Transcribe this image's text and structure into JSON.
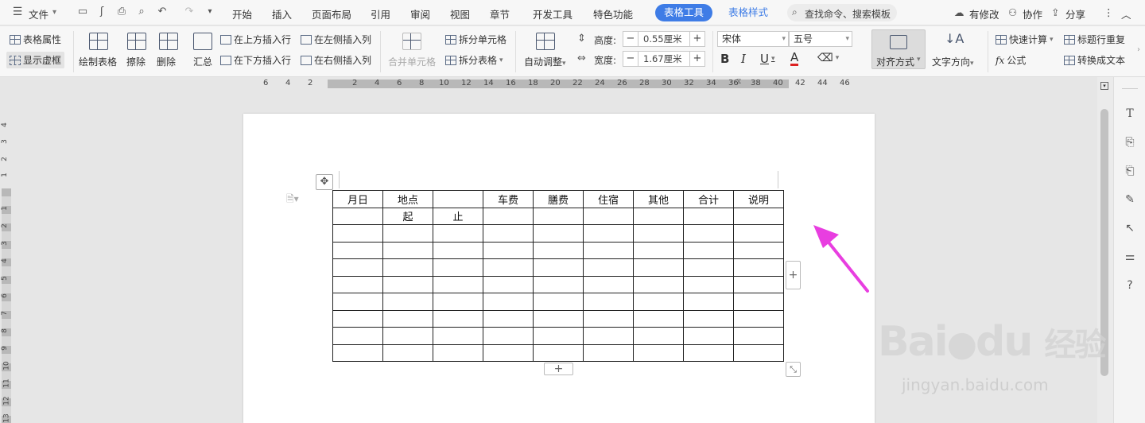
{
  "menubar": {
    "file_label": "文件",
    "tabs": [
      "开始",
      "插入",
      "页面布局",
      "引用",
      "审阅",
      "视图",
      "章节",
      "开发工具",
      "特色功能"
    ],
    "context_tab_active": "表格工具",
    "context_tab_2": "表格样式",
    "search_placeholder": "查找命令、搜索模板",
    "has_changes": "有修改",
    "collaborate": "协作",
    "share": "分享"
  },
  "ribbon": {
    "table_properties": "表格属性",
    "show_gridlines": "显示虚框",
    "draw_table": "绘制表格",
    "erase": "擦除",
    "delete": "删除",
    "summary": "汇总",
    "insert_row_above": "在上方插入行",
    "insert_row_below": "在下方插入行",
    "insert_col_left": "在左侧插入列",
    "insert_col_right": "在右侧插入列",
    "merge_cells": "合并单元格",
    "split_cells": "拆分单元格",
    "split_table": "拆分表格",
    "auto_fit": "自动调整",
    "height_label": "高度:",
    "height_value": "0.55厘米",
    "width_label": "宽度:",
    "width_value": "1.67厘米",
    "font_name": "宋体",
    "font_size": "五号",
    "align": "对齐方式",
    "text_direction": "文字方向",
    "quick_calc": "快速计算",
    "formula": "公式",
    "repeat_header": "标题行重复",
    "convert_to_text": "转换成文本"
  },
  "ruler": {
    "h_numbers": [
      "6",
      "4",
      "2",
      "2",
      "4",
      "6",
      "8",
      "10",
      "12",
      "14",
      "16",
      "18",
      "20",
      "22",
      "24",
      "26",
      "28",
      "30",
      "32",
      "34",
      "36",
      "38",
      "40",
      "42",
      "44",
      "46"
    ],
    "v_numbers": [
      "4",
      "3",
      "2",
      "1",
      "1",
      "2",
      "3",
      "4",
      "5",
      "6",
      "7",
      "8",
      "9",
      "10",
      "11",
      "12",
      "13"
    ]
  },
  "table": {
    "header": [
      "月日",
      "地点",
      "",
      "车费",
      "膳费",
      "住宿",
      "其他",
      "合计",
      "说明"
    ],
    "row2": [
      "",
      "起",
      "止",
      "",
      "",
      "",
      "",
      "",
      ""
    ],
    "empty_rows": 9
  },
  "watermark": {
    "brand": "Bai",
    "brand2": "du",
    "brand_cn": "经验",
    "url": "jingyan.baidu.com"
  },
  "colors": {
    "accent": "#3e7ce6",
    "arrow": "#e83ee0"
  }
}
